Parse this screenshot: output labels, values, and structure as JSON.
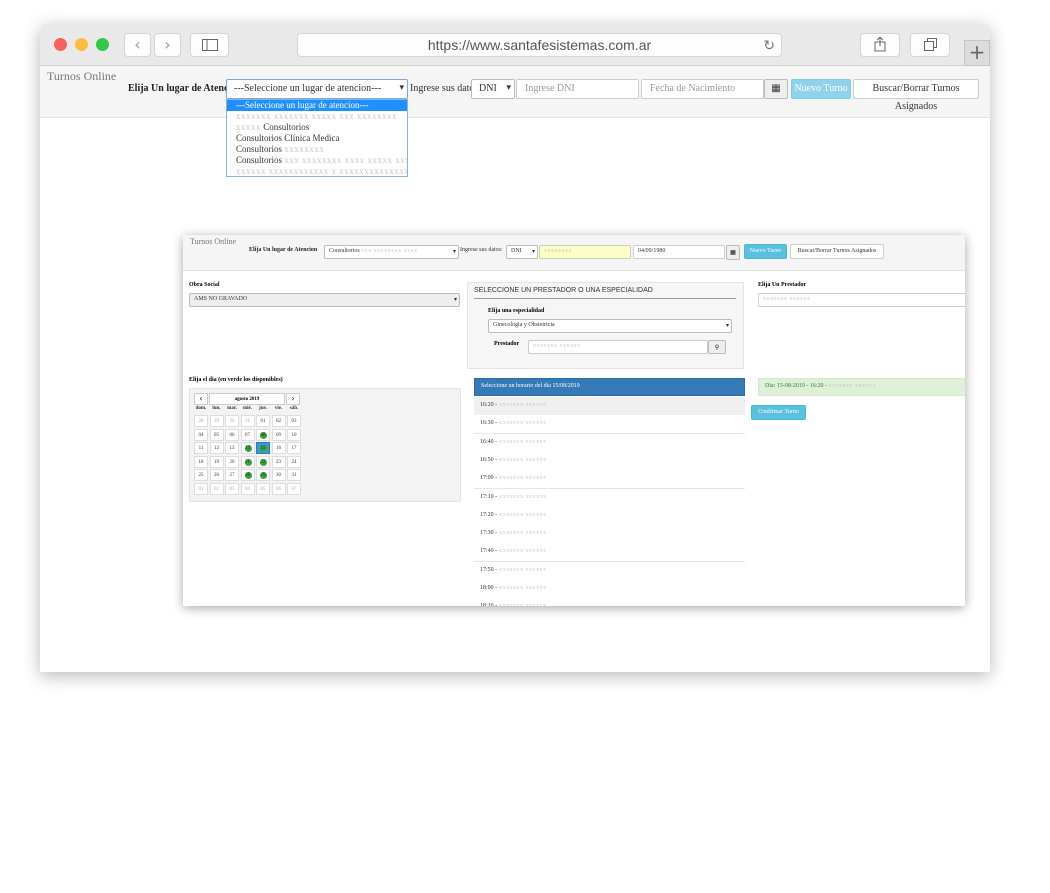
{
  "browser": {
    "url": "https://www.santafesistemas.com.ar",
    "back_icon": "chevron-left-icon",
    "forward_icon": "chevron-right-icon",
    "sidebar_icon": "sidebar-icon",
    "share_icon": "share-icon",
    "tabs_icon": "tabs-icon",
    "reload_icon": "reload-icon",
    "new_tab_icon": "plus-icon"
  },
  "nav": {
    "brand": "Turnos Online",
    "place_label": "Elija Un lugar de Atencion",
    "place_value": "---Seleccione un lugar de atencion---",
    "data_label": "Ingrese sus datos:",
    "doc_type": "DNI",
    "dni_placeholder": "Ingrese DNI",
    "birth_placeholder": "Fecha de Nacimiento",
    "calendar_icon": "calendar-icon",
    "new_button": "Nuevo Turno",
    "search_button": "Buscar/Borrar Turnos Asignados"
  },
  "dropdown": {
    "options": [
      {
        "label": "---Seleccione un lugar de atencion---",
        "selected": true,
        "blurred": false
      },
      {
        "label": "xxxxxxx xxxxxxx xxxxx xxx xxxxxxxx",
        "selected": false,
        "blurred": true
      },
      {
        "label": "Consultorios",
        "prefix": "xxxxx",
        "selected": false,
        "blurred": false
      },
      {
        "label": "Consultorios Clínica Medica",
        "selected": false,
        "blurred": false
      },
      {
        "label": "Consultorios",
        "suffix": "xxxxxxxx",
        "selected": false,
        "blurred": false
      },
      {
        "label": "Consultorios",
        "suffix": "xxx xxxxxxxx xxxx xxxxx xxxx",
        "selected": false,
        "blurred": false
      },
      {
        "label": "xxxxxx xxxxxxxxxxxx x xxxxxxxxxxxxxxxx",
        "selected": false,
        "blurred": true
      }
    ]
  },
  "inner": {
    "brand": "Turnos Online",
    "place_label": "Elija Un lugar de Atencion",
    "place_value": "Consultorios",
    "data_label": "Ingrese sus datos:",
    "doc_type": "DNI",
    "dni_value": "xxxxxxxx",
    "birth_value": "04/09/1980",
    "new_button": "Nuevo Turno",
    "search_button": "Buscar/Borrar Turnos Asignados",
    "obra_label": "Obra Social",
    "obra_value": "AMS NO GRAVADO",
    "prestador_title": "SELECCIONE UN PRESTADOR O UNA ESPECIALIDAD",
    "especialidad_label": "Elija una especialidad",
    "especialidad_value": "Ginecologia y Obstetricia",
    "prestador_label": "Prestador",
    "elija_prestador": "Elija Un Prestador",
    "day_label": "Elija el dia (en verde los disponibles)",
    "month": "agosto 2019",
    "weekdays": [
      "dom.",
      "lun.",
      "mar.",
      "mié.",
      "jue.",
      "vie.",
      "sáb."
    ],
    "weeks": [
      [
        {
          "d": "28",
          "m": true
        },
        {
          "d": "29",
          "m": true
        },
        {
          "d": "30",
          "m": true
        },
        {
          "d": "31",
          "m": true
        },
        {
          "d": "01"
        },
        {
          "d": "02"
        },
        {
          "d": "03"
        }
      ],
      [
        {
          "d": "04"
        },
        {
          "d": "05"
        },
        {
          "d": "06"
        },
        {
          "d": "07"
        },
        {
          "d": "08",
          "a": true
        },
        {
          "d": "09"
        },
        {
          "d": "10"
        }
      ],
      [
        {
          "d": "11"
        },
        {
          "d": "12"
        },
        {
          "d": "13"
        },
        {
          "d": "14",
          "a": true
        },
        {
          "d": "15",
          "a": true,
          "t": true
        },
        {
          "d": "16"
        },
        {
          "d": "17"
        }
      ],
      [
        {
          "d": "18"
        },
        {
          "d": "19"
        },
        {
          "d": "20"
        },
        {
          "d": "21",
          "a": true
        },
        {
          "d": "22",
          "a": true
        },
        {
          "d": "23"
        },
        {
          "d": "24"
        }
      ],
      [
        {
          "d": "25"
        },
        {
          "d": "26"
        },
        {
          "d": "27"
        },
        {
          "d": "28",
          "a": true
        },
        {
          "d": "29",
          "a": true
        },
        {
          "d": "30"
        },
        {
          "d": "31"
        }
      ],
      [
        {
          "d": "01",
          "m": true
        },
        {
          "d": "02",
          "m": true
        },
        {
          "d": "03",
          "m": true
        },
        {
          "d": "04",
          "m": true
        },
        {
          "d": "05",
          "m": true
        },
        {
          "d": "06",
          "m": true
        },
        {
          "d": "07",
          "m": true
        }
      ]
    ],
    "slots_header": "Seleccione un horario del dia 15/08/2019",
    "slots": [
      "16:20 -",
      "16:30 -",
      "16:40 -",
      "16:50 -",
      "17:00 -",
      "17:10 -",
      "17:20 -",
      "17:30 -",
      "17:40 -",
      "17:50 -",
      "18:00 -",
      "18:10 -"
    ],
    "selected_summary": "Dia: 15-08-2019 - 16:20 -",
    "confirm_button": "Confirmar Turno",
    "colors": {
      "primary": "#337ab7",
      "info": "#5bc0de",
      "success_bg": "#dff0d8",
      "available": "#3aa43a"
    }
  }
}
